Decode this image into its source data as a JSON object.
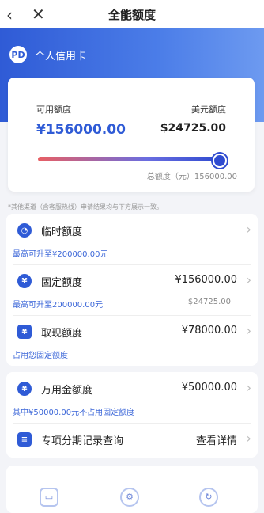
{
  "nav": {
    "back_icon": "‹",
    "close_icon": "✕",
    "title": "全能额度"
  },
  "brand": {
    "logo_text": "PD",
    "title": "个人信用卡"
  },
  "card": {
    "available_label": "可用额度",
    "available_value": "¥156000.00",
    "usd_label": "美元额度",
    "usd_value": "$24725.00",
    "total_text": "总额度（元）156000.00",
    "progress_fraction": 1.0
  },
  "note": "*其他渠道（含客服热线）申请结果均与下方展示一致。",
  "items": [
    {
      "name": "临时额度",
      "amount": "",
      "sub": "最高可升至¥200000.00元",
      "sub_right": ""
    },
    {
      "name": "固定额度",
      "amount": "¥156000.00",
      "sub": "最高可升至200000.00元",
      "sub_right": "$24725.00"
    },
    {
      "name": "取现额度",
      "amount": "¥78000.00",
      "sub": "占用您固定额度",
      "sub_right": ""
    }
  ],
  "items2": [
    {
      "name": "万用金额度",
      "amount": "¥50000.00",
      "sub": "其中¥50000.00元不占用固定额度"
    },
    {
      "name": "专项分期记录查询",
      "amount": "查看详情",
      "sub": ""
    }
  ],
  "colors": {
    "accent": "#2f5bd6",
    "link": "#3b66d8"
  }
}
